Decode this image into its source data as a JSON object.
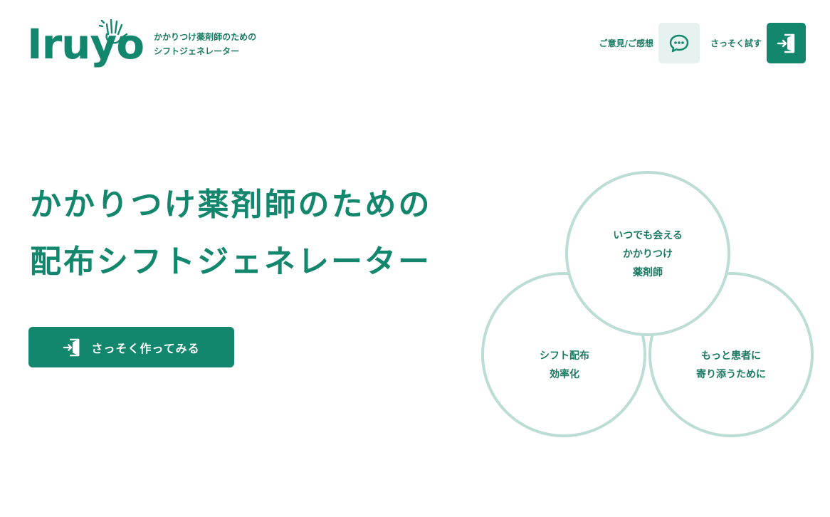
{
  "header": {
    "logo_text": "Iruyo",
    "tagline_line1": "かかりつけ薬剤師のための",
    "tagline_line2": "シフトジェネレーター",
    "feedback_label": "ご意見/ご感想",
    "try_label": "さっそく試す",
    "feedback_icon": "chat-bubble-icon",
    "try_icon": "enter-door-icon"
  },
  "hero": {
    "title_line1": "かかりつけ薬剤師のための",
    "title_line2": "配布シフトジェネレーター",
    "cta_label": "さっそく作ってみる",
    "cta_icon": "enter-door-icon"
  },
  "venn": {
    "top": [
      "いつでも会える",
      "かかりつけ",
      "薬剤師"
    ],
    "left": [
      "シフト配布",
      "効率化"
    ],
    "right": [
      "もっと患者に",
      "寄り添うために"
    ]
  },
  "colors": {
    "brand": "#13876d",
    "brand_light": "#e6f2ef",
    "circle_stroke": "#bcdcd6"
  }
}
